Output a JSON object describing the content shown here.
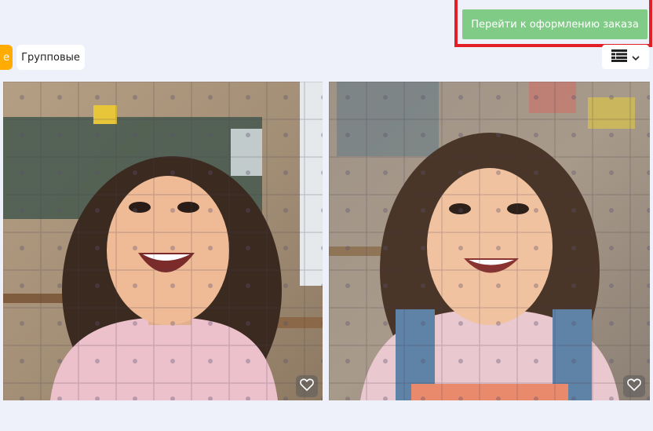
{
  "header": {
    "checkout_label": "Перейти к оформлению заказа"
  },
  "filters": {
    "active_chip_visible_text": "е",
    "group_label": "Групповые"
  },
  "view_toggle": {
    "icon": "grid-list-icon",
    "dropdown_icon": "chevron-down-icon"
  },
  "photos": [
    {
      "subject": "smiling girl in pink t-shirt, classroom background",
      "favorite_icon": "heart-outline-icon"
    },
    {
      "subject": "smiling girl in pink shirt and denim overalls",
      "favorite_icon": "heart-outline-icon"
    }
  ],
  "colors": {
    "checkout_button": "#80cc87",
    "highlight_frame": "#e41e26",
    "active_chip": "#ffab00",
    "background": "#eef1f9"
  }
}
